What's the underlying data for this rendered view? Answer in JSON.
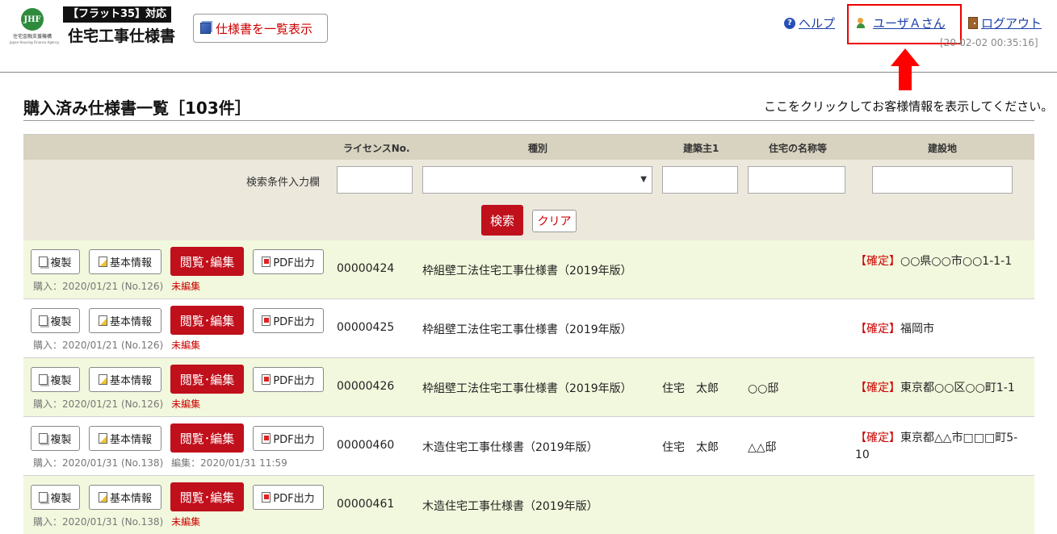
{
  "header": {
    "logo_mark": "JHF",
    "logo_org": "住宅金融支援機構",
    "logo_org_en": "Japan Housing Finance Agency",
    "badge": "【フラット35】対応",
    "app_title": "住宅工事仕様書",
    "list_button": "仕様書を一覧表示",
    "help": "ヘルプ",
    "user": "ユーザＡさん",
    "logout": "ログアウト",
    "timestamp": "[20-02-02 00:35:16]"
  },
  "page": {
    "title": "購入済み仕様書一覧［103件］",
    "hint": "ここをクリックしてお客様情報を表示してください。"
  },
  "table": {
    "headers": {
      "license": "ライセンスNo.",
      "type": "種別",
      "owner": "建築主1",
      "house": "住宅の名称等",
      "site": "建設地"
    },
    "search_label": "検索条件入力欄",
    "search_button": "検索",
    "clear_button": "クリア",
    "row_buttons": {
      "copy": "複製",
      "info": "基本情報",
      "edit": "閲覧･編集",
      "pdf": "PDF出力"
    },
    "rows": [
      {
        "purchase": "購入：2020/01/21 (No.126)",
        "edit_state": "未編集",
        "license": "00000424",
        "type": "枠組壁工法住宅工事仕様書（2019年版）",
        "owner": "",
        "house": "",
        "status": "【確定】",
        "site": "○○県○○市○○1-1-1"
      },
      {
        "purchase": "購入：2020/01/21 (No.126)",
        "edit_state": "未編集",
        "license": "00000425",
        "type": "枠組壁工法住宅工事仕様書（2019年版）",
        "owner": "",
        "house": "",
        "status": "【確定】",
        "site": "福岡市"
      },
      {
        "purchase": "購入：2020/01/21 (No.126)",
        "edit_state": "未編集",
        "license": "00000426",
        "type": "枠組壁工法住宅工事仕様書（2019年版）",
        "owner": "住宅　太郎",
        "house": "○○邸",
        "status": "【確定】",
        "site": "東京都○○区○○町1-1"
      },
      {
        "purchase": "購入：2020/01/31 (No.138)",
        "edit_state": "編集：2020/01/31 11:59",
        "license": "00000460",
        "type": "木造住宅工事仕様書（2019年版）",
        "owner": "住宅　太郎",
        "house": "△△邸",
        "status": "【確定】",
        "site": "東京都△△市□□□町5-10"
      },
      {
        "purchase": "購入：2020/01/31 (No.138)",
        "edit_state": "未編集",
        "license": "00000461",
        "type": "木造住宅工事仕様書（2019年版）",
        "owner": "",
        "house": "",
        "status": "",
        "site": ""
      }
    ]
  },
  "colors": {
    "accent_red": "#c0101c",
    "link_blue": "#1a3fa8",
    "row_alt": "#f2f8dd",
    "header_band": "#d8d2c0"
  }
}
